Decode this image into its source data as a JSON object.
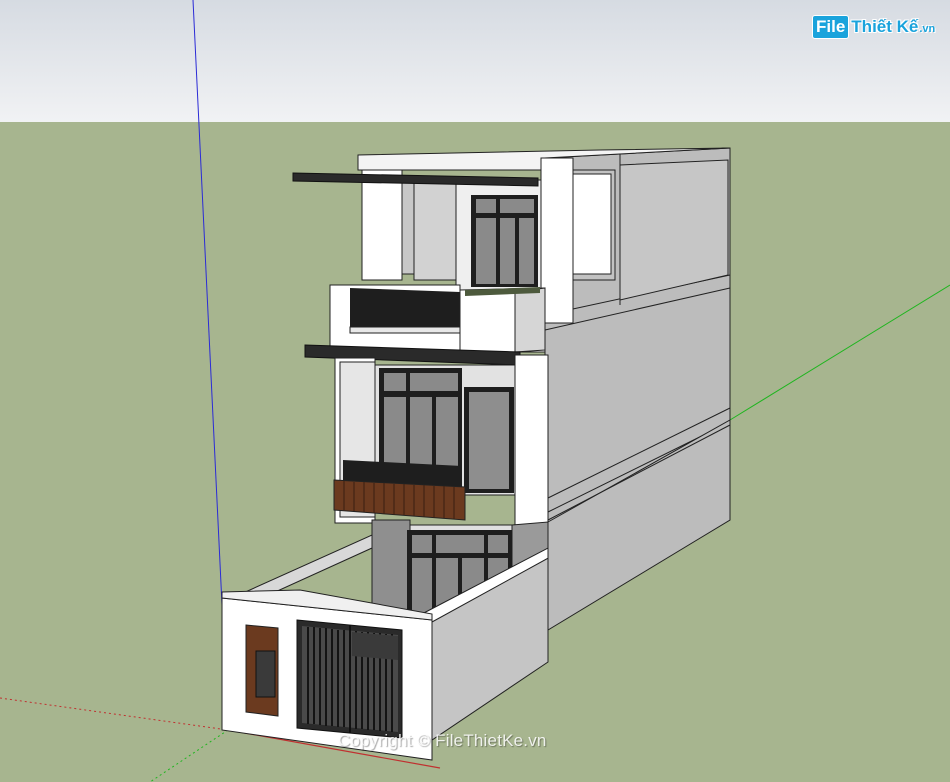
{
  "logo": {
    "box_text": "File",
    "name_text": "Thiết Kế",
    "tld_text": ".vn"
  },
  "watermark": {
    "text": "Copyright © FileThietKe.vn"
  },
  "colors": {
    "sky_top": "#d9dde3",
    "sky_bottom": "#f0f1f3",
    "ground": "#a7b58f",
    "wall_white": "#ffffff",
    "wall_side": "#b9b9b9",
    "glass": "#8a8a8a",
    "frame": "#1e1e1e",
    "wood": "#6b3a1f",
    "axis_blue": "#2b2bd6",
    "axis_green": "#1fb51f",
    "axis_red": "#c03030"
  }
}
